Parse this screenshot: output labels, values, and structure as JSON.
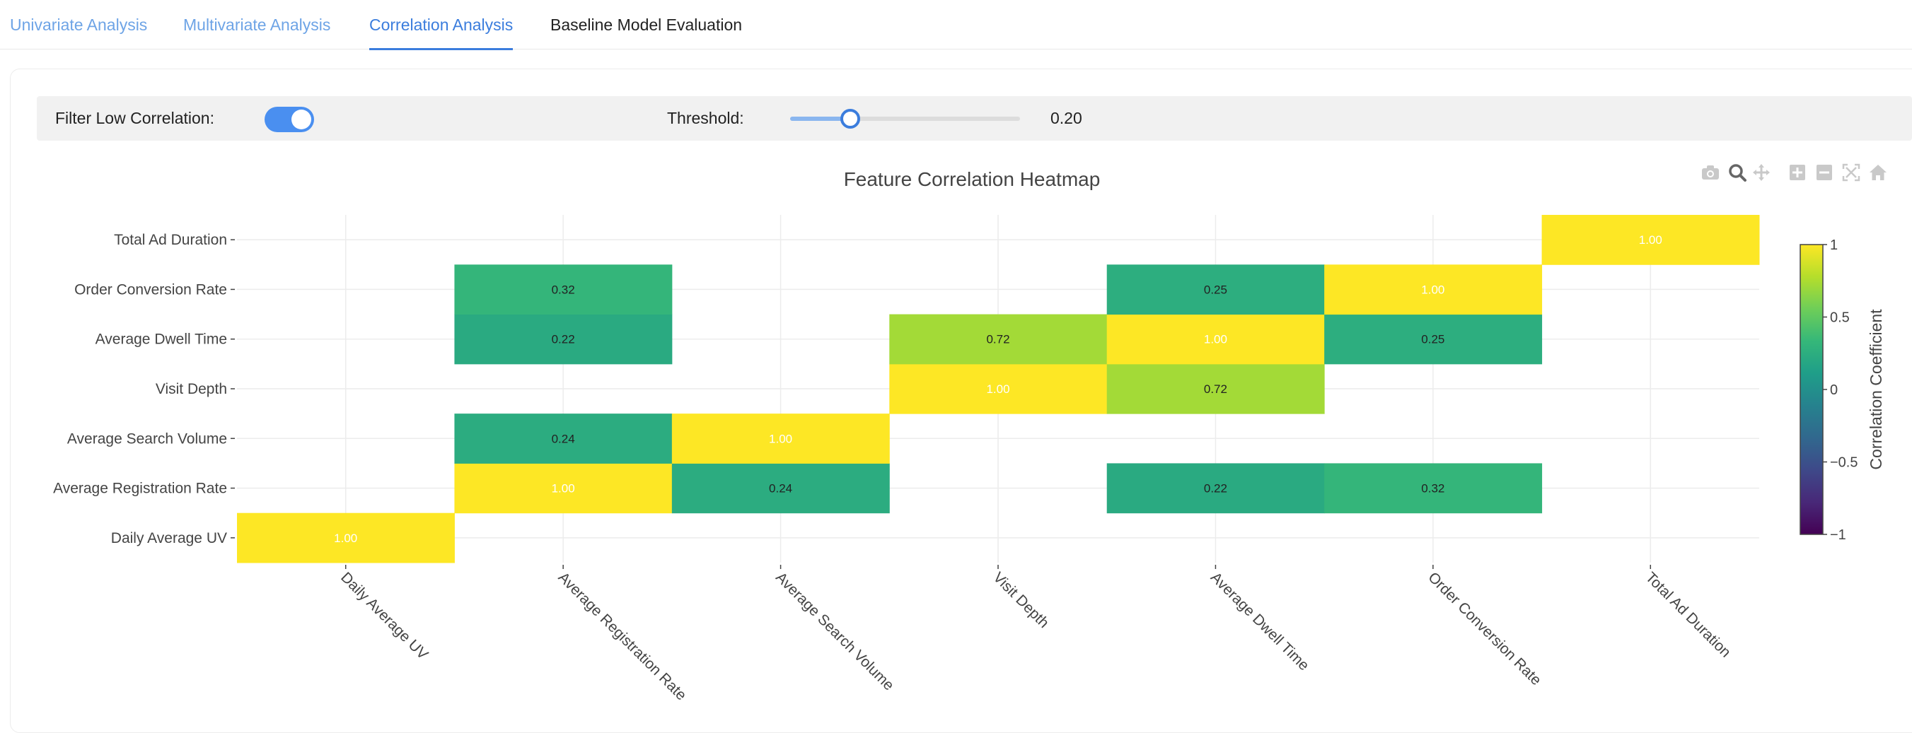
{
  "tabs": [
    {
      "label": "Univariate Analysis",
      "state": "normal"
    },
    {
      "label": "Multivariate Analysis",
      "state": "hover"
    },
    {
      "label": "Correlation Analysis",
      "state": "active"
    },
    {
      "label": "Baseline Model Evaluation",
      "state": "normal"
    }
  ],
  "controls": {
    "filter_label": "Filter Low Correlation:",
    "filter_enabled": true,
    "threshold_label": "Threshold:",
    "threshold_value": 0.2,
    "threshold_display": "0.20",
    "threshold_range": [
      0,
      1
    ]
  },
  "modebar": {
    "icons": [
      "camera-icon",
      "zoom-icon",
      "pan-icon",
      "zoom-in-icon",
      "zoom-out-icon",
      "autoscale-icon",
      "reset-axes-icon"
    ],
    "active": "zoom-icon"
  },
  "chart_data": {
    "type": "heatmap",
    "title": "Feature Correlation Heatmap",
    "x_categories": [
      "Daily Average UV",
      "Average Registration Rate",
      "Average Search Volume",
      "Visit Depth",
      "Average Dwell Time",
      "Order Conversion Rate",
      "Total Ad Duration"
    ],
    "y_categories": [
      "Daily Average UV",
      "Average Registration Rate",
      "Average Search Volume",
      "Visit Depth",
      "Average Dwell Time",
      "Order Conversion Rate",
      "Total Ad Duration"
    ],
    "z": [
      [
        1.0,
        null,
        null,
        null,
        null,
        null,
        null
      ],
      [
        null,
        1.0,
        0.24,
        null,
        0.22,
        0.32,
        null
      ],
      [
        null,
        0.24,
        1.0,
        null,
        null,
        null,
        null
      ],
      [
        null,
        null,
        null,
        1.0,
        0.72,
        null,
        null
      ],
      [
        null,
        0.22,
        null,
        0.72,
        1.0,
        0.25,
        null
      ],
      [
        null,
        0.32,
        null,
        null,
        0.25,
        1.0,
        null
      ],
      [
        null,
        null,
        null,
        null,
        null,
        null,
        1.0
      ]
    ],
    "colorscale": "viridis",
    "zrange": [
      -1,
      1
    ],
    "colorbar": {
      "title": "Correlation Coefficient",
      "tickvals": [
        1,
        0.5,
        0,
        -0.5,
        -1
      ],
      "ticktext": [
        "1",
        "0.5",
        "0",
        "−0.5",
        "−1"
      ]
    },
    "value_format": "2 decimals"
  }
}
